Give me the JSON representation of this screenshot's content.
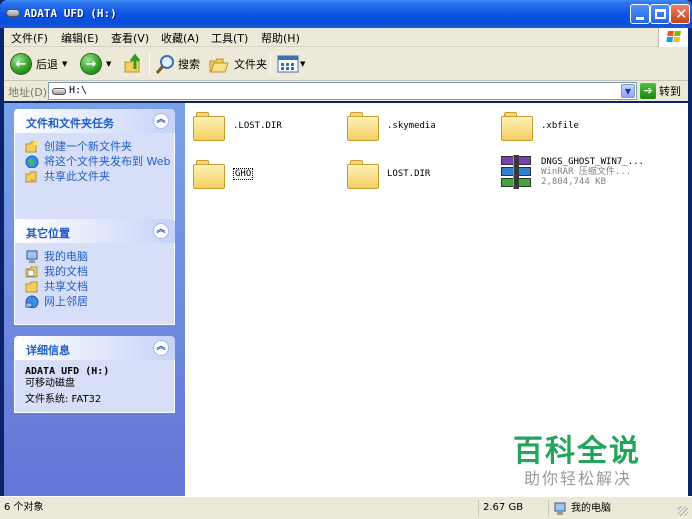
{
  "window": {
    "title": "ADATA UFD (H:)"
  },
  "menu": [
    "文件(F)",
    "编辑(E)",
    "查看(V)",
    "收藏(A)",
    "工具(T)",
    "帮助(H)"
  ],
  "toolbar": {
    "back": "后退",
    "search": "搜索",
    "folders": "文件夹"
  },
  "address": {
    "label": "地址(D)",
    "value": "H:\\",
    "go": "转到"
  },
  "sidebar": {
    "tasks": {
      "title": "文件和文件夹任务",
      "items": [
        "创建一个新文件夹",
        "将这个文件夹发布到 Web",
        "共享此文件夹"
      ]
    },
    "places": {
      "title": "其它位置",
      "items": [
        "我的电脑",
        "我的文档",
        "共享文档",
        "网上邻居"
      ]
    },
    "details": {
      "title": "详细信息",
      "name": "ADATA UFD (H:)",
      "type": "可移动磁盘",
      "fs": "文件系统: FAT32"
    }
  },
  "files": [
    {
      "name": ".LOST.DIR",
      "kind": "folder"
    },
    {
      "name": ".skymedia",
      "kind": "folder"
    },
    {
      "name": ".xbfile",
      "kind": "folder"
    },
    {
      "name": "GHO",
      "kind": "folder"
    },
    {
      "name": "LOST.DIR",
      "kind": "folder"
    },
    {
      "name": "DNGS_GHOST_WIN7_...",
      "type": "WinRAR 压缩文件...",
      "size": "2,804,744 KB",
      "kind": "rar"
    }
  ],
  "watermark": {
    "main": "百科全说",
    "sub": "助你轻松解决"
  },
  "status": {
    "count": "6 个对象",
    "size": "2.67 GB",
    "location": "我的电脑"
  },
  "colors": {
    "title_blue": "#0b55e3",
    "sidebar_top": "#7ba2e7",
    "link": "#215dc6",
    "watermark": "#23a45a"
  }
}
